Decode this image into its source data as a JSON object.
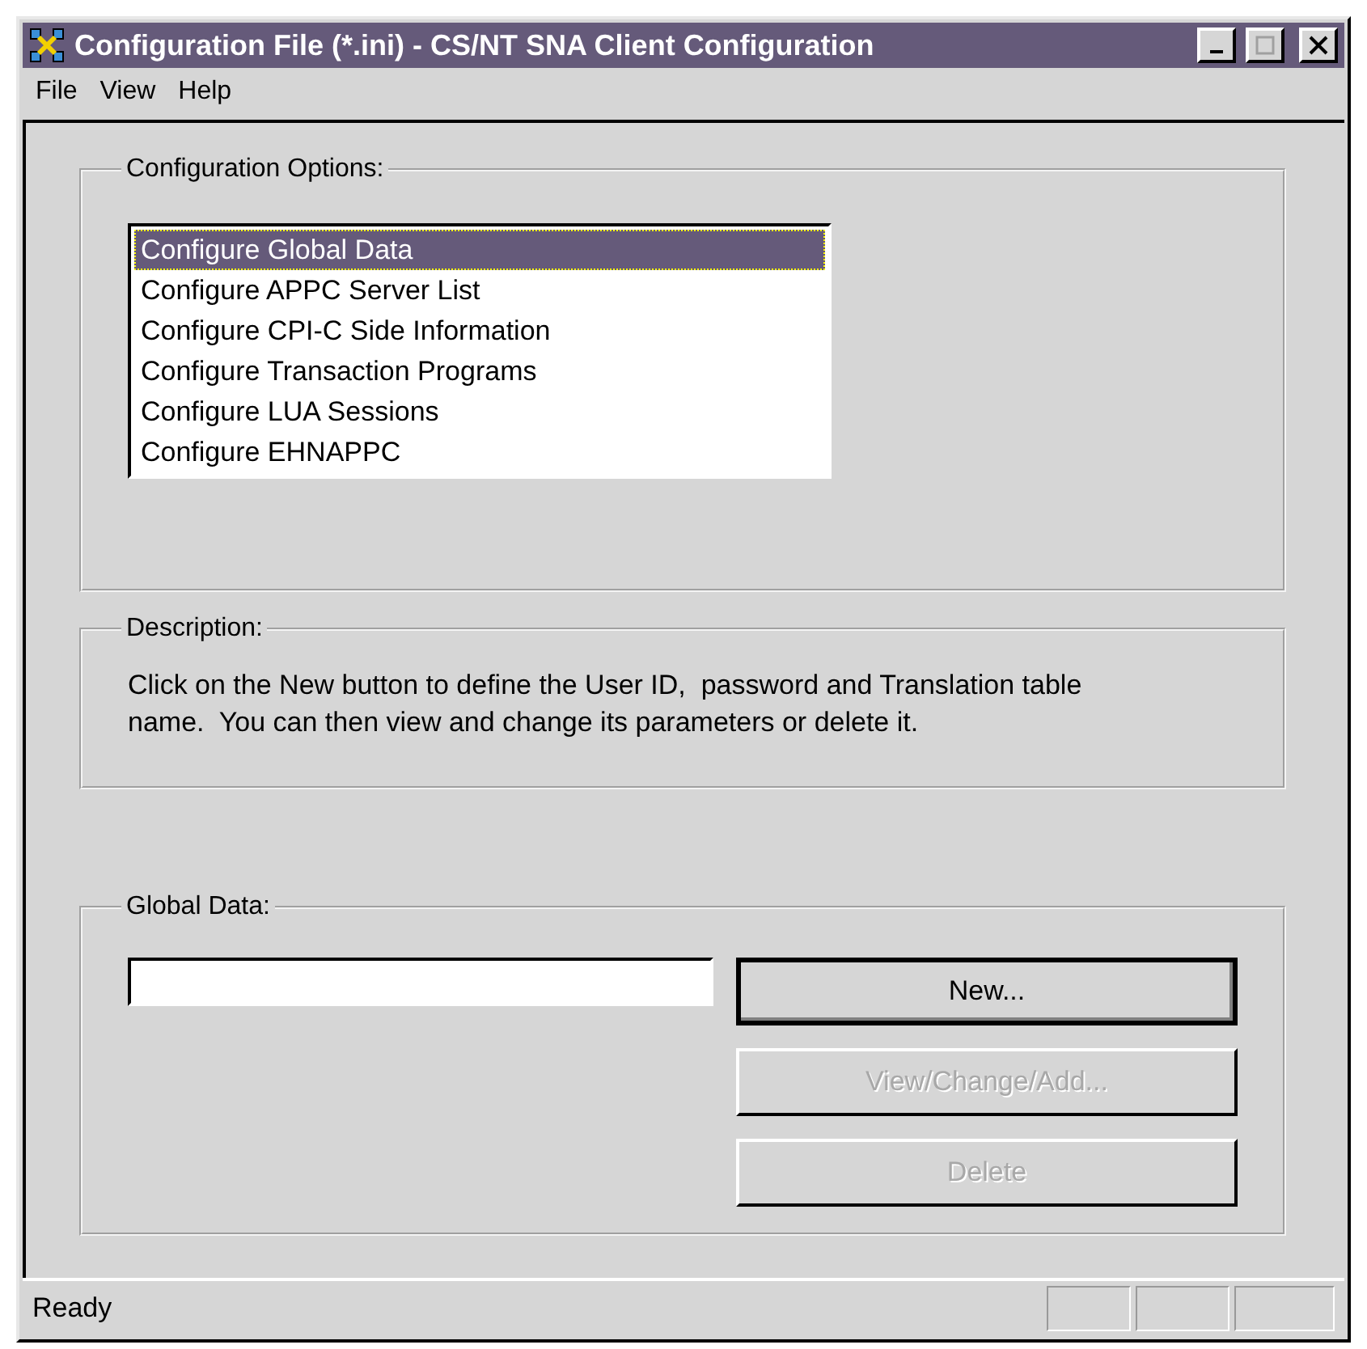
{
  "window": {
    "title": "Configuration File (*.ini) - CS/NT SNA Client Configuration"
  },
  "menu": [
    {
      "label": "File"
    },
    {
      "label": "View"
    },
    {
      "label": "Help"
    }
  ],
  "options": {
    "label": "Configuration Options:",
    "items": [
      {
        "label": "Configure Global Data",
        "selected": true
      },
      {
        "label": "Configure APPC Server List",
        "selected": false
      },
      {
        "label": "Configure CPI-C Side Information",
        "selected": false
      },
      {
        "label": "Configure Transaction Programs",
        "selected": false
      },
      {
        "label": "Configure LUA Sessions",
        "selected": false
      },
      {
        "label": "Configure EHNAPPC",
        "selected": false
      }
    ]
  },
  "description": {
    "label": "Description:",
    "text": "Click on the New button to define the User ID,  password and Translation table name.  You can then view and change its parameters or delete it."
  },
  "global_data": {
    "label": "Global Data:",
    "buttons": [
      {
        "label": "New...",
        "disabled": false,
        "default": true
      },
      {
        "label": "View/Change/Add...",
        "disabled": true,
        "default": false
      },
      {
        "label": "Delete",
        "disabled": true,
        "default": false
      }
    ]
  },
  "status_bar": {
    "text": "Ready"
  }
}
